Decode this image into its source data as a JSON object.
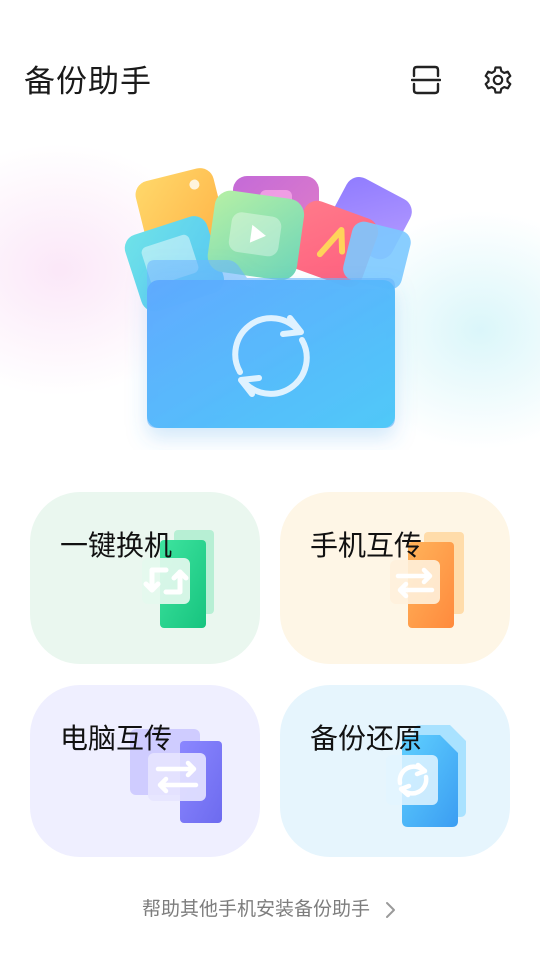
{
  "header": {
    "title": "备份助手",
    "scan_icon": "scan-icon",
    "settings_icon": "gear-icon"
  },
  "hero": {
    "illustration": "folder-sync-illustration"
  },
  "cards": [
    {
      "label": "一键换机",
      "icon": "phone-switch-icon",
      "accent": "#1bcf8c",
      "background": "#eaf7ef"
    },
    {
      "label": "手机互传",
      "icon": "phone-transfer-icon",
      "accent": "#ff9a45",
      "background": "#fef6e6"
    },
    {
      "label": "电脑互传",
      "icon": "pc-transfer-icon",
      "accent": "#7b78f0",
      "background": "#efefff"
    },
    {
      "label": "备份还原",
      "icon": "backup-restore-icon",
      "accent": "#3aa8f5",
      "background": "#e6f5fd"
    }
  ],
  "footer": {
    "link_text": "帮助其他手机安装备份助手",
    "chevron_icon": "chevron-right-icon"
  }
}
